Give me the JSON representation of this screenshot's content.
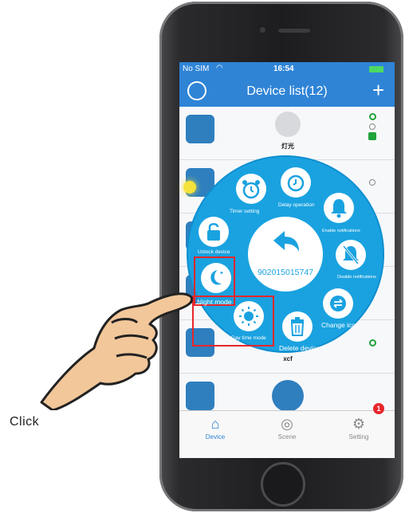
{
  "status_bar": {
    "carrier": "No SIM",
    "time": "16:54"
  },
  "header": {
    "title": "Device list(12)",
    "add_symbol": "+"
  },
  "devices": [
    {
      "name": "灯光"
    },
    {
      "name": "xcf"
    }
  ],
  "tabs": [
    {
      "label": "Device",
      "icon": "home-icon"
    },
    {
      "label": "Scene",
      "icon": "scene-icon"
    },
    {
      "label": "Setting",
      "icon": "gear-icon"
    }
  ],
  "tab_badge": "1",
  "radial_menu": {
    "device_id": "902015015747",
    "items": {
      "timer": "Timer setting",
      "delay": "Delay operation",
      "notify_on": "Enable notifications",
      "unlock": "Unlock device",
      "notify_off": "Disable notifications",
      "night": "Night mode",
      "change_icon": "Change icon",
      "day": "Day time mode",
      "delete": "Delete device"
    }
  },
  "annotation": {
    "text": "Click"
  },
  "colors": {
    "accent": "#2f84d6",
    "menu": "#1aa2e0",
    "highlight": "#e8262b"
  }
}
